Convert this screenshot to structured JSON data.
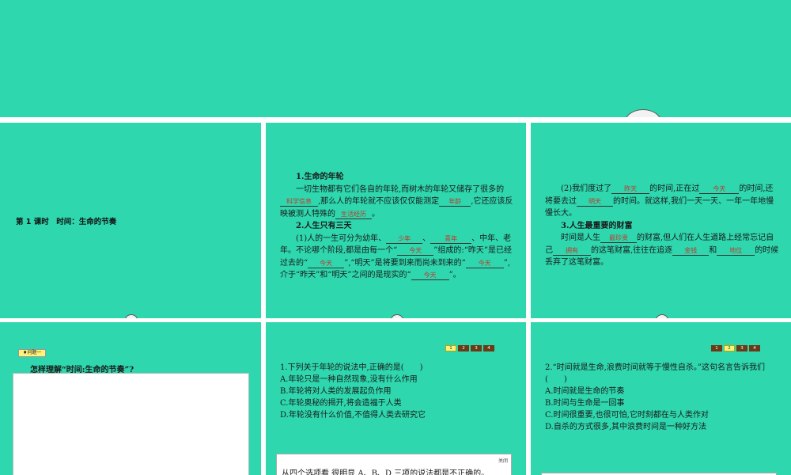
{
  "slide1": {
    "title": "第 1 课时　时间：生命的节奏"
  },
  "slide2": {
    "h1": "1.生命的年轮",
    "p1a": "一切生物都有它们各自的年轮,而树木的年轮又储存了很多的",
    "b1": "科学信息",
    "p1b": ",那么人的年轮就不应该仅仅能测定",
    "b2": "年龄",
    "p1c": ",它还应该反映被测人特殊的",
    "b3": "生活经历",
    "p1d": "。",
    "h2": "2.人生只有三天",
    "p2a": "(1)人的一生可分为幼年、",
    "b4": "少年",
    "p2b": "、",
    "b5": "青年",
    "p2c": "、中年、老年。不论哪个阶段,都是由每一个“",
    "b6": "今天",
    "p2d": "”组成的:“昨天”是已经过去的“",
    "b7": "今天",
    "p2e": "”,“明天”是将要到来而尚未到来的“",
    "b8": "今天",
    "p2f": "”,介于“昨天”和“明天”之间的是现实的“",
    "b9": "今天",
    "p2g": "”。"
  },
  "slide3": {
    "p1a": "(2)我们度过了",
    "b1": "昨天",
    "p1b": "的时间,正在过",
    "b2": "今天",
    "p1c": "的时间,还将要去过",
    "b3": "明天",
    "p1d": "的时间。就这样,我们一天一天、一年一年地慢慢长大。",
    "h3": "3.人生最重要的财富",
    "p2a": "时间是人生",
    "b4": "最珍贵",
    "p2b": "的财富,但人们在人生道路上经常忘记自己",
    "b5": "拥有",
    "p2c": "的这笔财富,往往在追逐",
    "b6": "金钱",
    "p2d": "和",
    "b7": "地位",
    "p2e": "的时候丢弃了这笔财富。"
  },
  "slide4": {
    "badge": "♦问题一",
    "question": "怎样理解“时间:生命的节奏”?"
  },
  "slide5": {
    "nav": [
      "1",
      "2",
      "3",
      "4"
    ],
    "q": "1.下列关于年轮的说法中,正确的是(　　)",
    "a": "A.年轮只是一种自然现象,没有什么作用",
    "b": "B.年轮将对人类的发展起负作用",
    "c": "C.年轮奥秘的揭开,将会造福于人类",
    "d": "D.年轮没有什么价值,不值得人类去研究它",
    "close": "关闭",
    "answer": "从四个选项看,很明显 A、B、D 三项的说法都是不正确的。"
  },
  "slide6": {
    "nav": [
      "1",
      "2",
      "3",
      "4"
    ],
    "q": "2.“时间就是生命,浪费时间就等于慢性自杀。”这句名言告诉我们(　　)",
    "a": "A.时间就是生命的节奏",
    "b": "B.时间与生命是一回事",
    "c": "C.时间很重要,也很可怕,它时刻都在与人类作对",
    "d": "D.自杀的方式很多,其中浪费时间是一种好方法"
  },
  "colors": {
    "slide_bg": "#2ed7ae",
    "answer_red": "#c0392b",
    "nav_active": "#fff27a",
    "nav_inactive": "#6b3a16"
  }
}
